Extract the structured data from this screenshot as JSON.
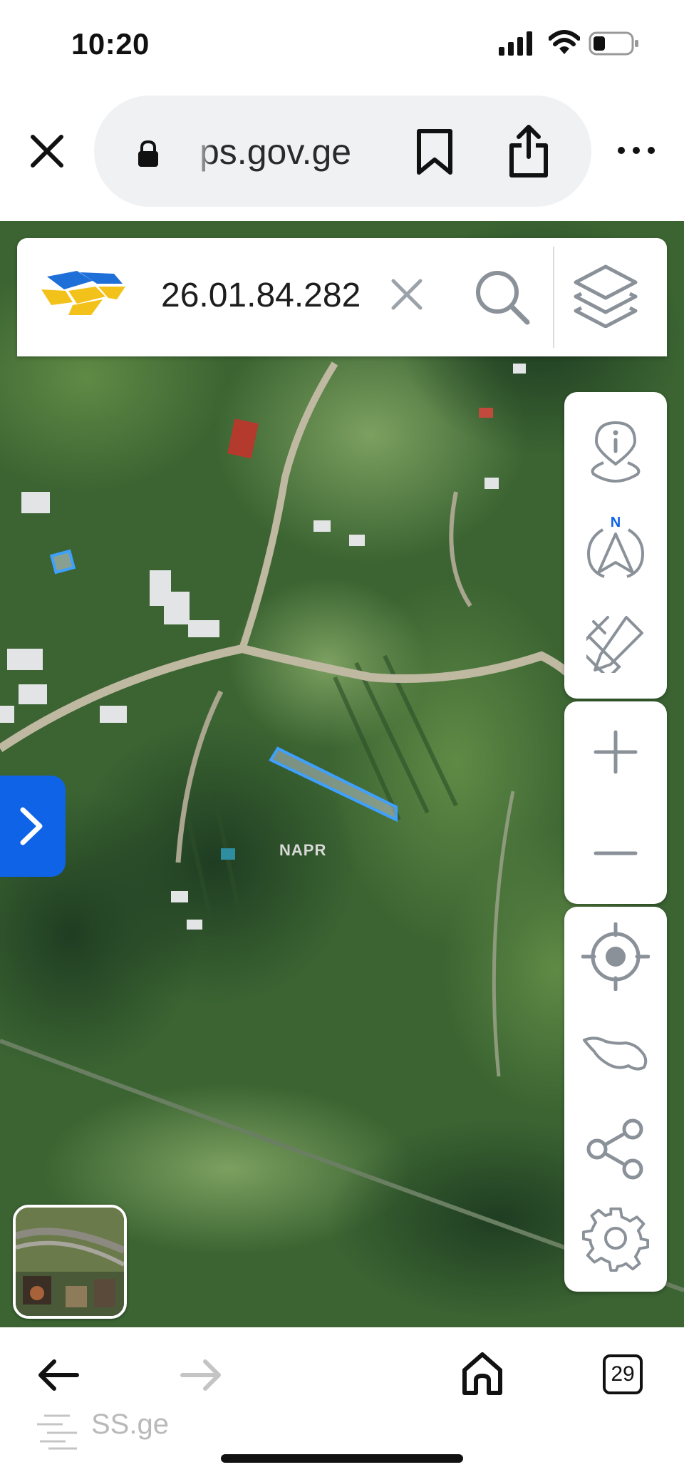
{
  "status_bar": {
    "time": "10:20",
    "icons": [
      "signal-icon",
      "wifi-icon",
      "battery-icon"
    ]
  },
  "browser": {
    "url": "ps.gov.ge",
    "buttons": [
      "close-icon",
      "lock-icon",
      "bookmark-icon",
      "share-icon",
      "more-icon"
    ]
  },
  "search": {
    "value": "26.01.84.282",
    "icons": [
      "logo",
      "clear-icon",
      "search-icon",
      "layers-icon"
    ]
  },
  "toolbar": {
    "tools": [
      "info-icon",
      "compass-icon",
      "measure-icon",
      "zoom-in-icon",
      "zoom-out-icon",
      "locate-icon",
      "georgia-map-icon",
      "share-network-icon",
      "settings-icon"
    ],
    "compass_label": "N"
  },
  "map": {
    "watermark": "NAPR",
    "parcel_color": "#3ea0ff"
  },
  "bottom_bar": {
    "tab_count": "29",
    "watermark": "SS.ge",
    "icons": [
      "back-arrow-icon",
      "forward-arrow-icon",
      "home-icon",
      "tabs-icon"
    ]
  },
  "colors": {
    "accent": "#0e63e6",
    "logo_blue": "#1f6fd8",
    "logo_yellow": "#f2c21b",
    "icon_gray": "#8a9199"
  }
}
